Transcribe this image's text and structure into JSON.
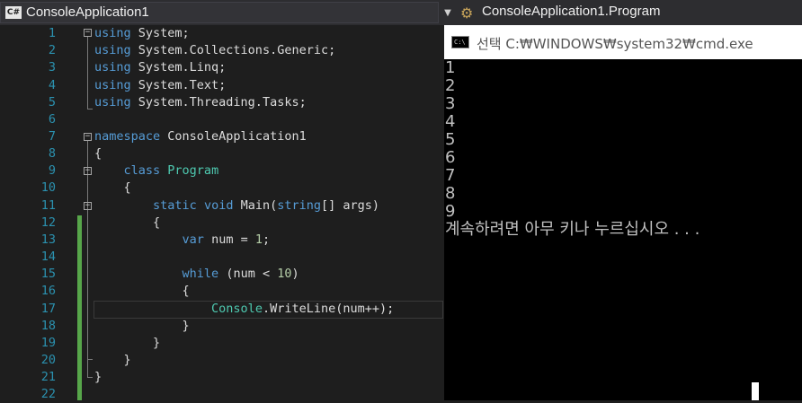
{
  "navbar": {
    "project": "ConsoleApplication1",
    "project_icon": "csharp-project-icon",
    "member": "ConsoleApplication1.Program",
    "member_icon": "class-icon"
  },
  "editor": {
    "line_numbers": [
      "1",
      "2",
      "3",
      "4",
      "5",
      "6",
      "7",
      "8",
      "9",
      "10",
      "11",
      "12",
      "13",
      "14",
      "15",
      "16",
      "17",
      "18",
      "19",
      "20",
      "21",
      "22"
    ],
    "colors": {
      "keyword": "#569cd6",
      "type": "#4ec9b0",
      "text": "#dcdcdc",
      "number": "#b5cea8",
      "line_number": "#2b91af",
      "change_bar": "#57a64a"
    }
  },
  "console": {
    "title": "선택 C:₩WINDOWS₩system32₩cmd.exe",
    "icon": "cmd-icon",
    "output": [
      "1",
      "2",
      "3",
      "4",
      "5",
      "6",
      "7",
      "8",
      "9",
      "계속하려면 아무 키나 누르십시오 . . ."
    ]
  }
}
